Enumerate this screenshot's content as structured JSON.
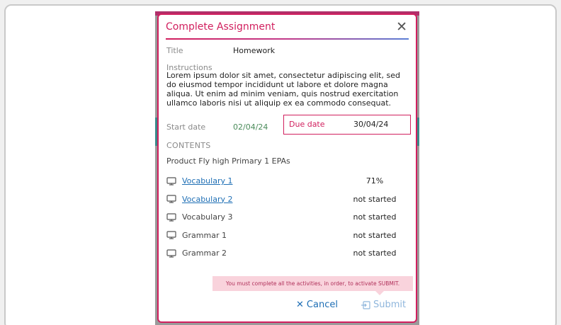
{
  "modal": {
    "title": "Complete Assignment",
    "close_icon": "close-icon"
  },
  "assignment": {
    "title_label": "Title",
    "title_value": "Homework",
    "instructions_label": "Instructions",
    "instructions_text": "Lorem ipsum dolor sit amet, consectetur adipiscing elit, sed do eiusmod tempor incididunt ut labore et dolore magna aliqua. Ut enim ad minim veniam, quis nostrud exercitation ullamco laboris nisi ut aliquip ex ea commodo consequat.",
    "start_date_label": "Start date",
    "start_date_value": "02/04/24",
    "due_date_label": "Due date",
    "due_date_value": "30/04/24"
  },
  "contents": {
    "heading": "CONTENTS",
    "product": "Product Fly high Primary 1 EPAs",
    "items": [
      {
        "name": "Vocabulary 1",
        "status": "71%",
        "link": true,
        "icon": "monitor-icon"
      },
      {
        "name": "Vocabulary 2",
        "status": "not started",
        "link": true,
        "icon": "monitor-icon"
      },
      {
        "name": "Vocabulary 3",
        "status": "not started",
        "link": false,
        "icon": "monitor-icon"
      },
      {
        "name": "Grammar 1",
        "status": "not started",
        "link": false,
        "icon": "monitor-icon"
      },
      {
        "name": "Grammar 2",
        "status": "not started",
        "link": false,
        "icon": "monitor-icon"
      }
    ]
  },
  "tooltip": {
    "text": "You must complete all the activities, in order, to activate SUBMIT."
  },
  "footer": {
    "cancel_label": "Cancel",
    "submit_label": "Submit"
  },
  "colors": {
    "accent": "#d11f5e",
    "link": "#1f6fb5",
    "start_date": "#4a8b5a",
    "tooltip_bg": "#f9d3dc",
    "submit_disabled": "#8fb6dc"
  }
}
